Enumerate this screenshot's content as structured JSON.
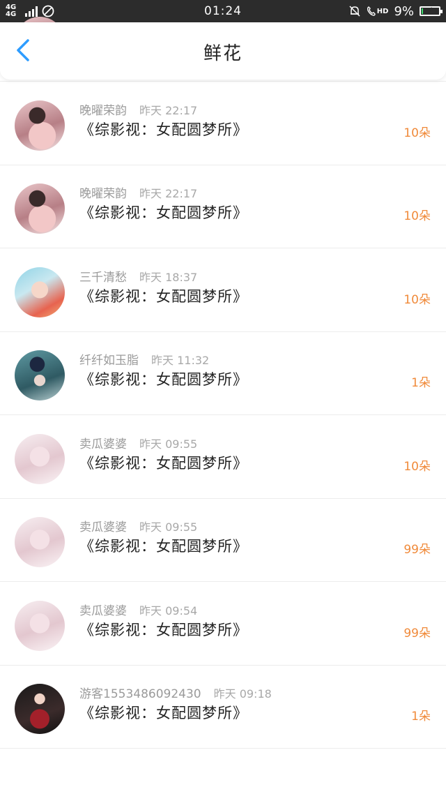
{
  "status_bar": {
    "network": "4G 4G",
    "time": "01:24",
    "hd": "HD",
    "battery": "9%",
    "battery_level": 0.09,
    "icons": [
      "signal-icon",
      "no-disturb-icon",
      "bell-off-icon",
      "hd-call-icon",
      "battery-icon"
    ]
  },
  "header": {
    "title": "鲜花",
    "back_icon": "back-chevron-icon",
    "accent_color": "#2d9cff"
  },
  "colors": {
    "count": "#f08a3a",
    "meta": "#9a9a9a"
  },
  "records": [
    {
      "name": "",
      "time": "",
      "book": "《综影视：女配圆梦所》",
      "count": "10朵",
      "avatar": "pink-girl"
    },
    {
      "name": "晚曜荣韵",
      "time": "昨天 22:17",
      "book": "《综影视：女配圆梦所》",
      "count": "10朵",
      "avatar": "pink-girl"
    },
    {
      "name": "晚曜荣韵",
      "time": "昨天 22:17",
      "book": "《综影视：女配圆梦所》",
      "count": "10朵",
      "avatar": "pink-girl"
    },
    {
      "name": "三千清愁",
      "time": "昨天 18:37",
      "book": "《综影视：女配圆梦所》",
      "count": "10朵",
      "avatar": "anime-girl"
    },
    {
      "name": "纤纤如玉脂",
      "time": "昨天 11:32",
      "book": "《综影视：女配圆梦所》",
      "count": "1朵",
      "avatar": "cap-girl"
    },
    {
      "name": "卖瓜婆婆",
      "time": "昨天 09:55",
      "book": "《综影视：女配圆梦所》",
      "count": "10朵",
      "avatar": "pale-girl"
    },
    {
      "name": "卖瓜婆婆",
      "time": "昨天 09:55",
      "book": "《综影视：女配圆梦所》",
      "count": "99朵",
      "avatar": "pale-girl"
    },
    {
      "name": "卖瓜婆婆",
      "time": "昨天 09:54",
      "book": "《综影视：女配圆梦所》",
      "count": "99朵",
      "avatar": "pale-girl"
    },
    {
      "name": "游客1553486092430",
      "time": "昨天 09:18",
      "book": "《综影视：女配圆梦所》",
      "count": "1朵",
      "avatar": "red-dress-girl"
    }
  ]
}
